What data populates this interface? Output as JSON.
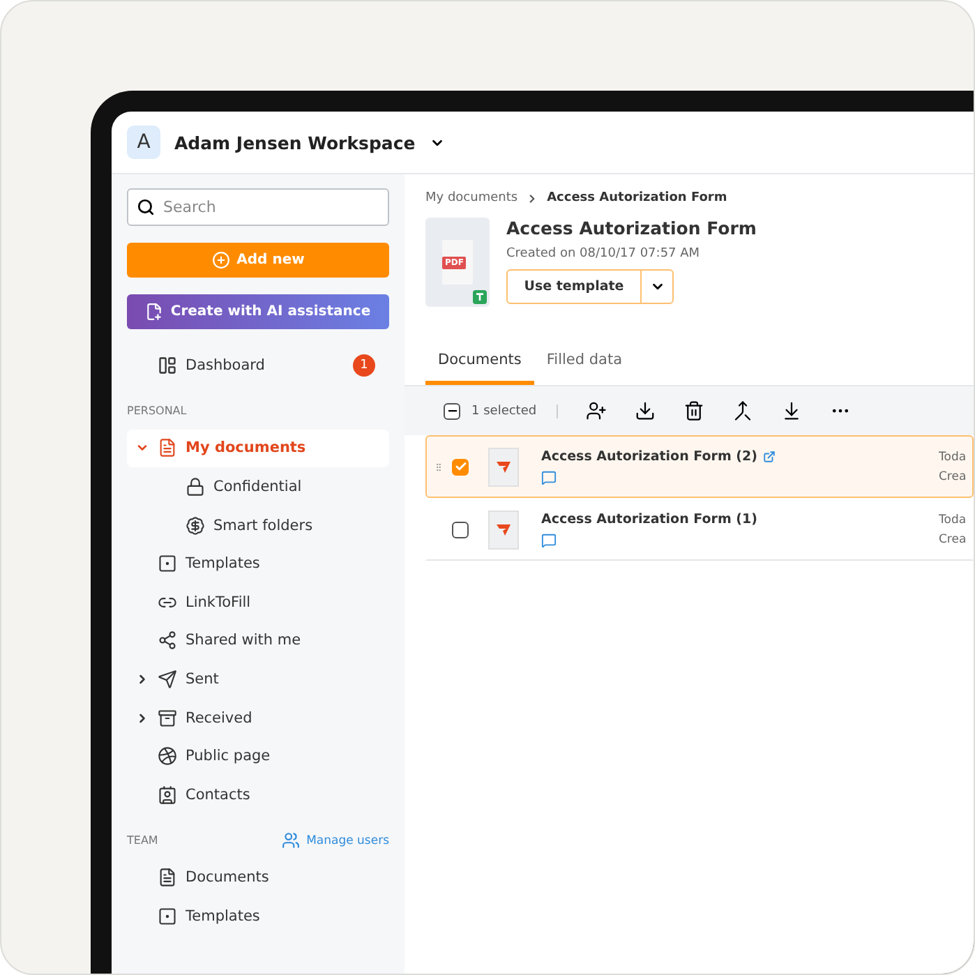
{
  "workspace": {
    "avatar": "A",
    "name": "Adam Jensen Workspace"
  },
  "sidebar": {
    "search": {
      "placeholder": "Search"
    },
    "add_button": "Add new",
    "ai_button": "Create with AI assistance",
    "dashboard": {
      "label": "Dashboard",
      "badge": "1"
    },
    "personal_heading": "PERSONAL",
    "personal_items": [
      {
        "label": "My documents",
        "selected": true,
        "expanded": true,
        "children": [
          {
            "label": "Confidential"
          },
          {
            "label": "Smart folders"
          }
        ]
      },
      {
        "label": "Templates",
        "selected": false
      },
      {
        "label": "LinkToFill",
        "selected": false
      },
      {
        "label": "Shared with me",
        "selected": false
      },
      {
        "label": "Sent",
        "selected": false,
        "expanded": false
      },
      {
        "label": "Received",
        "selected": false,
        "expanded": false
      },
      {
        "label": "Public page",
        "selected": false
      },
      {
        "label": "Contacts",
        "selected": false
      }
    ],
    "team_heading": "TEAM",
    "manage_users": "Manage users",
    "team_items": [
      {
        "label": "Documents",
        "selected": false
      },
      {
        "label": "Templates",
        "selected": false
      }
    ]
  },
  "breadcrumb": [
    "My documents",
    "Access Autorization Form"
  ],
  "document": {
    "badge": "PDF",
    "title": "Access Autorization Form",
    "created": "Created on 08/10/17 07:57 AM",
    "use_template": "Use template"
  },
  "tabs": [
    {
      "label": "Documents",
      "selected": true
    },
    {
      "label": "Filled data",
      "selected": false
    }
  ],
  "toolbar": {
    "select_all_partial": true,
    "selected_count": "1 selected"
  },
  "rows": [
    {
      "name": "Access Autorization Form (2)",
      "checked": true,
      "shared_link": true,
      "column_3": "Toda",
      "column_4": "Crea"
    },
    {
      "name": "Access Autorization Form (1)",
      "checked": false,
      "shared_link": false,
      "column_3": "Toda",
      "column_4": "Crea"
    }
  ]
}
